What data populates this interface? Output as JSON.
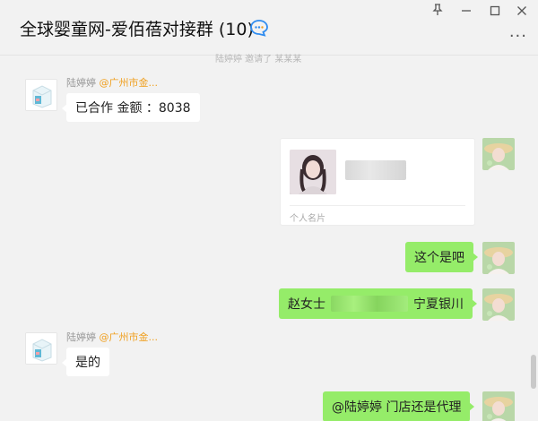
{
  "window": {
    "title": "全球婴童网-爱佰蓓对接群 (10)",
    "controls": {
      "pin": "pin-icon",
      "minimize": "minimize-icon",
      "maximize": "maximize-icon",
      "close": "close-icon",
      "more": "more-icon"
    }
  },
  "faded_line": "陆婷婷 邀请了 某某某",
  "messages": [
    {
      "side": "left",
      "sender": "陆婷婷",
      "location": "@广州市金...",
      "text": "已合作  金额 ：8038"
    },
    {
      "side": "right",
      "type": "contact-card",
      "card_label": "个人名片"
    },
    {
      "side": "right",
      "text": "这个是吧"
    },
    {
      "side": "right",
      "text_before": "赵女士",
      "text_after": "宁夏银川"
    },
    {
      "side": "left",
      "sender": "陆婷婷",
      "location": "@广州市金...",
      "text": "是的"
    },
    {
      "side": "right",
      "text": "@陆婷婷 门店还是代理"
    }
  ],
  "colors": {
    "background": "#f2f2f2",
    "self_bubble": "#95ec69",
    "other_bubble": "#ffffff",
    "location_accent": "#f0a020",
    "chat_icon": "#2f8cf0"
  }
}
